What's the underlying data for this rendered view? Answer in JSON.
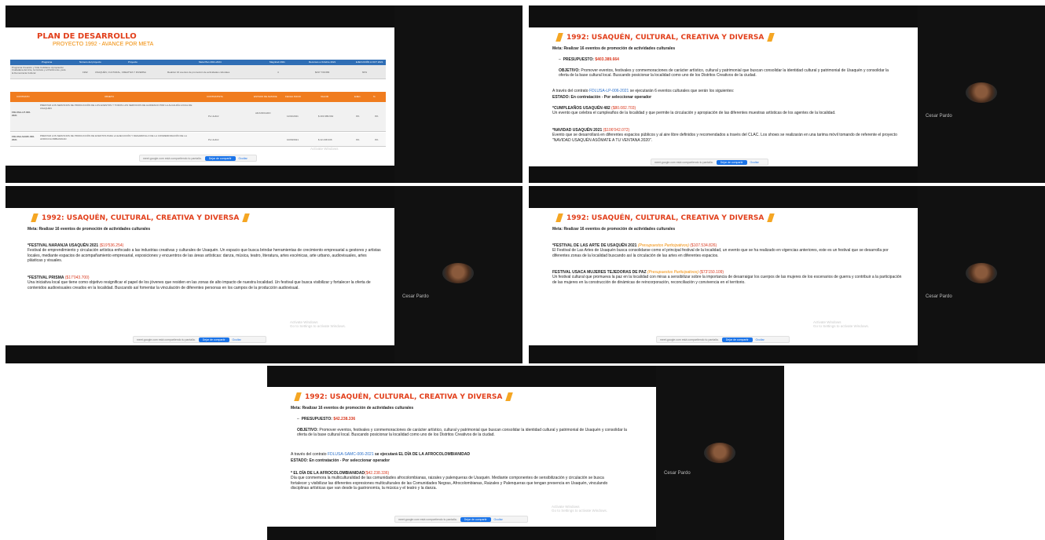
{
  "participant": {
    "name": "Cesar Pardo"
  },
  "share_bar": {
    "text": "meet.google.com está compartiendo tu pantalla.",
    "stop_label": "Dejar de compartir",
    "hide_label": "Ocultar"
  },
  "watermark": {
    "line1": "Activate Windows",
    "line2": "Go to Settings to activate Windows."
  },
  "slide1": {
    "title": "PLAN DE DESARROLLO",
    "subtitle": "PROYECTO 1992 - AVANCE POR META",
    "table1_headers": [
      "Programa",
      "Número del proyecto",
      "Proyecto",
      "Meta Plan 2021-2024",
      "Magnitud 2021",
      "Recursos a Octubre 2021",
      "EJECUCIÓN A OCT 2021"
    ],
    "table1_row": [
      "Programa Creación y Vida Cotidiana: Apropiación Ciudadana del Arte, la Cultura y el Patrimonio, para la Democracia Cultural",
      "1992",
      "USAQUÉN, CULTURAL, CREATIVA Y DIVERSA",
      "Realizar 16 eventos de promoción de actividades culturales",
      "4",
      "$437.739.684",
      "60%"
    ],
    "table2_headers": [
      "CONTRATO",
      "OBJETO",
      "CONTRATISTA",
      "ESTADO DE AVANCE",
      "FECHA INICIO",
      "VALOR",
      "EJEC.",
      "%"
    ],
    "table2_row1": [
      "FDLUSA-LP-006-2021",
      "PRESTAR LOS SERVICIOS DE PRODUCCIÓN DE LOS EVENTOS Y TODOS LOS SERVICIOS DE ALFRESCO POR LA ALCALDÍA LOCAL DE USAQUÉN",
      "Por definir",
      "ADJUDICADO",
      "11/01/2021",
      "$ 403.389.664",
      "0%",
      "0%"
    ],
    "table2_row2": [
      "FDLUSA-SAMC-006-2021",
      "PRESTAR LOS SERVICIOS DE PRODUCCIÓN DE EVENTOS PARA LA EJECUCIÓN Y DESARROLLO DE LA CONMEMORACIÓN DE LA AFROCOLOMBIANIDAD",
      "Por definir",
      "",
      "10/09/2021",
      "$ 42.238.336",
      "0%",
      "0%"
    ]
  },
  "slide2": {
    "title": "1992: USAQUÉN, CULTURAL, CREATIVA Y DIVERSA",
    "meta": "Meta: Realizar 16 eventos de promoción de actividades culturales",
    "presupuesto_label": "PRESUPUESTO:",
    "presupuesto_value": "$403.389.664",
    "objetivo_label": "OBJETIVO:",
    "objetivo_text": "Promover eventos, festivales y conmemoraciones de carácter artístico, cultural y patrimonial que buscan consolidar la identidad cultural y patrimonial de Usaquén y consolidar la oferta de la base cultural local. Buscando posicionar la localidad como uno de los Distritos Creativos de la ciudad.",
    "contrato_prefix": "A través del contrato",
    "contrato": "FDLUSA-LP-006-2021",
    "contrato_suffix": "se ejecutarán 6 eventos culturales que serán los siguientes:",
    "estado": "ESTADO: En contratación - Por seleccionar operador",
    "e1_title": "*CUMPLEAÑOS USAQUÉN 482",
    "e1_value": "($80.082.703)",
    "e1_text": "Un evento que celebra el cumpleaños de la localidad y que permite la circulación y apropiación de las diferentes muestras artísticas de los agentes de la localidad.",
    "e2_title": "*NAVIDAD USAQUÉN 2021",
    "e2_value": "($106'042.072)",
    "e2_text": "Evento que se desarrollará en diferentes espacios públicos y al aire libre definidos y recomendados a través del CLAC. Los shows se realizarán en una tarima móvil tomando de referente el proyecto \"NAVIDAD USAQUÉN ASÓMATE A TU VENTANA 2020\"."
  },
  "slide3": {
    "title": "1992: USAQUÉN, CULTURAL, CREATIVA Y DIVERSA",
    "meta": "Meta: Realizar 16 eventos de promoción de actividades culturales",
    "e1_title": "*FESTIVAL NARANJA USAQUÉN 2021",
    "e1_value": "($19'536.254)",
    "e1_text": "Festival de emprendimiento y circulación artística enfocado a las industrias creativas y culturales de Usaquén. Un espacio que busca brindar herramientas de crecimiento empresarial a gestores y artistas locales, mediante espacios de acompañamiento empresarial, exposiciones y encuentros de las áreas artísticas: danza, música, teatro, literatura, artes escénicas, arte urbano, audiovisuales, artes plásticas y visuales.",
    "e2_title": "*FESTIVAL PRISMA",
    "e2_value": "($17'043.700)",
    "e2_text": "Una iniciativa local que tiene como objetivo resignificar el papel de los jóvenes que residen en las zonas de alto impacto de nuestra localidad. Un festival que busca visibilizar y fortalecer la oferta de contenidos audiovisuales creados en la localidad. Buscando así fomentar la vinculación de diferentes personas en los campos de la producción audiovisual."
  },
  "slide4": {
    "title": "1992: USAQUÉN, CULTURAL, CREATIVA Y DIVERSA",
    "meta": "Meta: Realizar 16 eventos de promoción de actividades culturales",
    "e1_title": "*FESTIVAL DE LAS ARTE DE USAQUÉN 2021",
    "e1_tag": "(Presupuestos Participativos)",
    "e1_value": "($107.534.826)",
    "e1_text": "El Festival de Las Artes de Usaquén busca consolidarse como el principal festival de la localidad, un evento que se ha realizado en vigencias anteriores, este es un festival que se desarrolla por diferentes zonas de la localidad buscando así la circulación de las artes en diferentes espacios.",
    "e2_title": "FESTIVAL USACA MUJERES TEJEDORAS DE PAZ",
    "e2_tag": "(Presupuestos Participativos)",
    "e2_value": "($73'150.109)",
    "e2_text": "Un festival cultural que promueva la paz en la localidad con miras a sensibilizar sobre la importancia de desarraigar los cuerpos de las mujeres de los escenarios de guerra y contribuir a la participación de las mujeres en la construcción de dinámicas de reincorporación, reconciliación y convivencia en el territorio."
  },
  "slide5": {
    "title": "1992: USAQUÉN, CULTURAL, CREATIVA Y DIVERSA",
    "meta": "Meta: Realizar 16 eventos de promoción de actividades culturales",
    "presupuesto_label": "PRESUPUESTO:",
    "presupuesto_value": "$42.238.336",
    "objetivo_label": "OBJETIVO:",
    "objetivo_text": "Promover eventos, festivales y conmemoraciones de carácter artístico, cultural y patrimonial que buscan consolidar la identidad cultural y patrimonial de Usaquén y consolidar la oferta de la base cultural local. Buscando posicionar la localidad como uno de los Distritos Creativos de la ciudad.",
    "contrato_prefix": "A través del contrato",
    "contrato": "FDLUSA-SAMC-006-2021",
    "contrato_suffix": "se ejecutará EL DÍA DE LA AFROCOLOMBIANIDAD",
    "estado": "ESTADO: En contratación - Por seleccionar operador",
    "e1_title": "* EL DÍA DE LA AFROCOLOMBIANIDAD",
    "e1_value": "($42.238.336)",
    "e1_text": "Día que conmemora la multiculturalidad de las comunidades afrocolombianas, raizales y palenqueras de Usaquén. Mediante componentes de sensibilización y circulación se busca fortalecer y visibilizar las diferentes expresiones multiculturales de las Comunidades Negras, Afrocolombianas, Raizales y Palenqueras que tengan presencia en Usaquén, vinculando disciplinas artísticas que van desde la gastronomía, la música y el teatro y la danza."
  }
}
